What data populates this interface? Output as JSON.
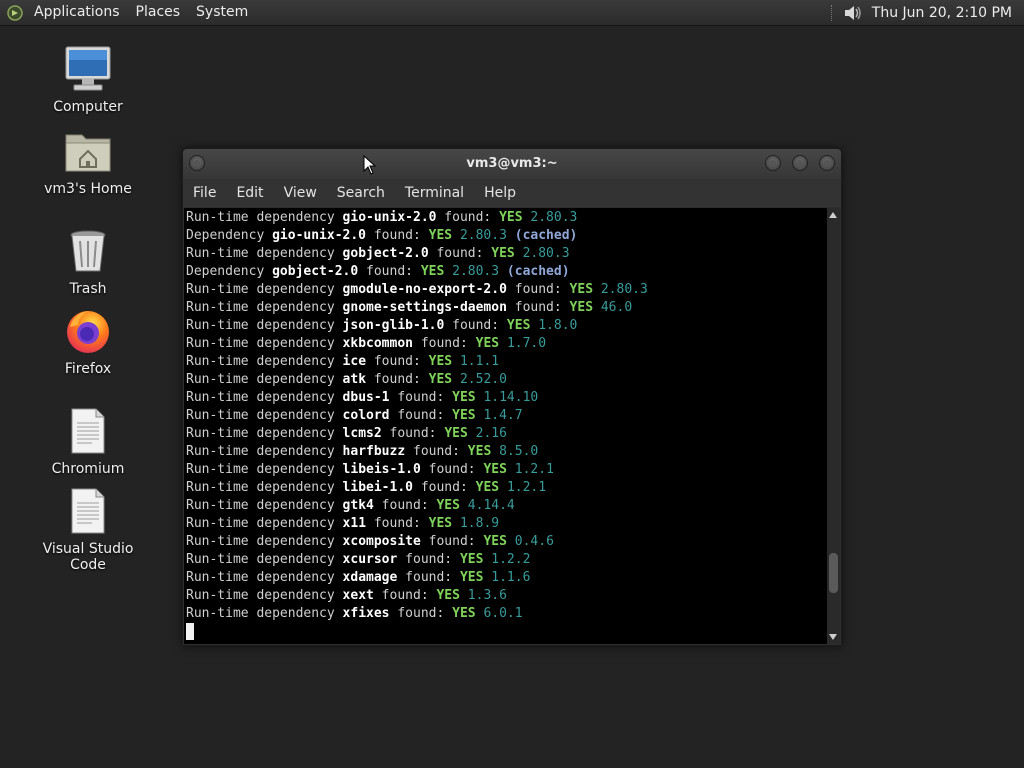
{
  "panel": {
    "menus": [
      "Applications",
      "Places",
      "System"
    ],
    "clock": "Thu Jun 20,  2:10 PM",
    "icons": {
      "logo": "mate-logo-icon",
      "volume": "volume-icon"
    }
  },
  "desktop": {
    "icons": [
      {
        "label": "Computer",
        "icon": "computer-icon"
      },
      {
        "label": "vm3's Home",
        "icon": "home-folder-icon"
      },
      {
        "label": "Trash",
        "icon": "trash-icon"
      },
      {
        "label": "Firefox",
        "icon": "firefox-icon"
      },
      {
        "label": "Chromium",
        "icon": "document-icon"
      },
      {
        "label": "Visual Studio Code",
        "icon": "document-icon"
      }
    ]
  },
  "terminal": {
    "title": "vm3@vm3:~",
    "menu": [
      "File",
      "Edit",
      "View",
      "Search",
      "Terminal",
      "Help"
    ],
    "colors": {
      "yes": "#7fd35a",
      "version": "#3a9b9b",
      "cached": "#8fa8d8",
      "background": "#000000"
    },
    "scroll_fraction": 0.9,
    "lines": [
      {
        "prefix": "Run-time dependency ",
        "name": "gio-unix-2.0",
        "mid": " found: ",
        "yes": "YES",
        "version": "2.80.3",
        "cached": ""
      },
      {
        "prefix": "Dependency ",
        "name": "gio-unix-2.0",
        "mid": " found: ",
        "yes": "YES",
        "version": "2.80.3",
        "cached": "(cached)"
      },
      {
        "prefix": "Run-time dependency ",
        "name": "gobject-2.0",
        "mid": " found: ",
        "yes": "YES",
        "version": "2.80.3",
        "cached": ""
      },
      {
        "prefix": "Dependency ",
        "name": "gobject-2.0",
        "mid": " found: ",
        "yes": "YES",
        "version": "2.80.3",
        "cached": "(cached)"
      },
      {
        "prefix": "Run-time dependency ",
        "name": "gmodule-no-export-2.0",
        "mid": " found: ",
        "yes": "YES",
        "version": "2.80.3",
        "cached": ""
      },
      {
        "prefix": "Run-time dependency ",
        "name": "gnome-settings-daemon",
        "mid": " found: ",
        "yes": "YES",
        "version": "46.0",
        "cached": ""
      },
      {
        "prefix": "Run-time dependency ",
        "name": "json-glib-1.0",
        "mid": " found: ",
        "yes": "YES",
        "version": "1.8.0",
        "cached": ""
      },
      {
        "prefix": "Run-time dependency ",
        "name": "xkbcommon",
        "mid": " found: ",
        "yes": "YES",
        "version": "1.7.0",
        "cached": ""
      },
      {
        "prefix": "Run-time dependency ",
        "name": "ice",
        "mid": " found: ",
        "yes": "YES",
        "version": "1.1.1",
        "cached": ""
      },
      {
        "prefix": "Run-time dependency ",
        "name": "atk",
        "mid": " found: ",
        "yes": "YES",
        "version": "2.52.0",
        "cached": ""
      },
      {
        "prefix": "Run-time dependency ",
        "name": "dbus-1",
        "mid": " found: ",
        "yes": "YES",
        "version": "1.14.10",
        "cached": ""
      },
      {
        "prefix": "Run-time dependency ",
        "name": "colord",
        "mid": " found: ",
        "yes": "YES",
        "version": "1.4.7",
        "cached": ""
      },
      {
        "prefix": "Run-time dependency ",
        "name": "lcms2",
        "mid": " found: ",
        "yes": "YES",
        "version": "2.16",
        "cached": ""
      },
      {
        "prefix": "Run-time dependency ",
        "name": "harfbuzz",
        "mid": " found: ",
        "yes": "YES",
        "version": "8.5.0",
        "cached": ""
      },
      {
        "prefix": "Run-time dependency ",
        "name": "libeis-1.0",
        "mid": " found: ",
        "yes": "YES",
        "version": "1.2.1",
        "cached": ""
      },
      {
        "prefix": "Run-time dependency ",
        "name": "libei-1.0",
        "mid": " found: ",
        "yes": "YES",
        "version": "1.2.1",
        "cached": ""
      },
      {
        "prefix": "Run-time dependency ",
        "name": "gtk4",
        "mid": " found: ",
        "yes": "YES",
        "version": "4.14.4",
        "cached": ""
      },
      {
        "prefix": "Run-time dependency ",
        "name": "x11",
        "mid": " found: ",
        "yes": "YES",
        "version": "1.8.9",
        "cached": ""
      },
      {
        "prefix": "Run-time dependency ",
        "name": "xcomposite",
        "mid": " found: ",
        "yes": "YES",
        "version": "0.4.6",
        "cached": ""
      },
      {
        "prefix": "Run-time dependency ",
        "name": "xcursor",
        "mid": " found: ",
        "yes": "YES",
        "version": "1.2.2",
        "cached": ""
      },
      {
        "prefix": "Run-time dependency ",
        "name": "xdamage",
        "mid": " found: ",
        "yes": "YES",
        "version": "1.1.6",
        "cached": ""
      },
      {
        "prefix": "Run-time dependency ",
        "name": "xext",
        "mid": " found: ",
        "yes": "YES",
        "version": "1.3.6",
        "cached": ""
      },
      {
        "prefix": "Run-time dependency ",
        "name": "xfixes",
        "mid": " found: ",
        "yes": "YES",
        "version": "6.0.1",
        "cached": ""
      }
    ]
  }
}
